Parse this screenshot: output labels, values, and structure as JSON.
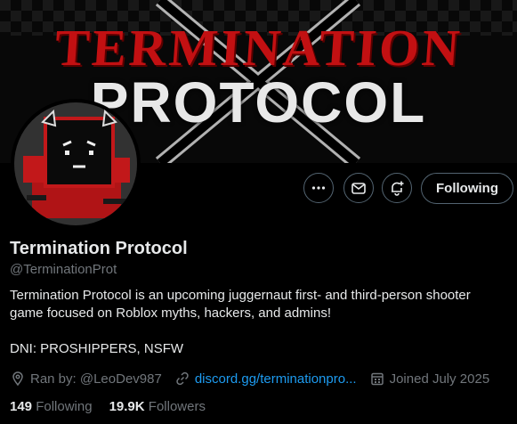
{
  "banner": {
    "line1": "TERMINATION",
    "line2": "PROTOCOL"
  },
  "profile": {
    "name": "Termination Protocol",
    "handle": "@TerminationProt",
    "bio_line1": "Termination Protocol is an upcoming juggernaut first- and third-person shooter",
    "bio_line2": "game focused on Roblox myths, hackers, and admins!",
    "bio_line3": "DNI: PROSHIPPERS, NSFW"
  },
  "actions": {
    "more_icon": "more-icon",
    "message_icon": "envelope-icon",
    "notify_icon": "bell-plus-icon",
    "follow_label": "Following"
  },
  "meta": {
    "location": "Ran by: @LeoDev987",
    "link": "discord.gg/terminationpro...",
    "joined": "Joined July 2025"
  },
  "stats": {
    "following_count": "149",
    "following_label": "Following",
    "followers_count": "19.9K",
    "followers_label": "Followers"
  },
  "colors": {
    "background": "#000000",
    "text": "#e7e9ea",
    "muted": "#71767b",
    "link": "#1d9bf0",
    "border": "#536471",
    "banner_red": "#c21012"
  }
}
